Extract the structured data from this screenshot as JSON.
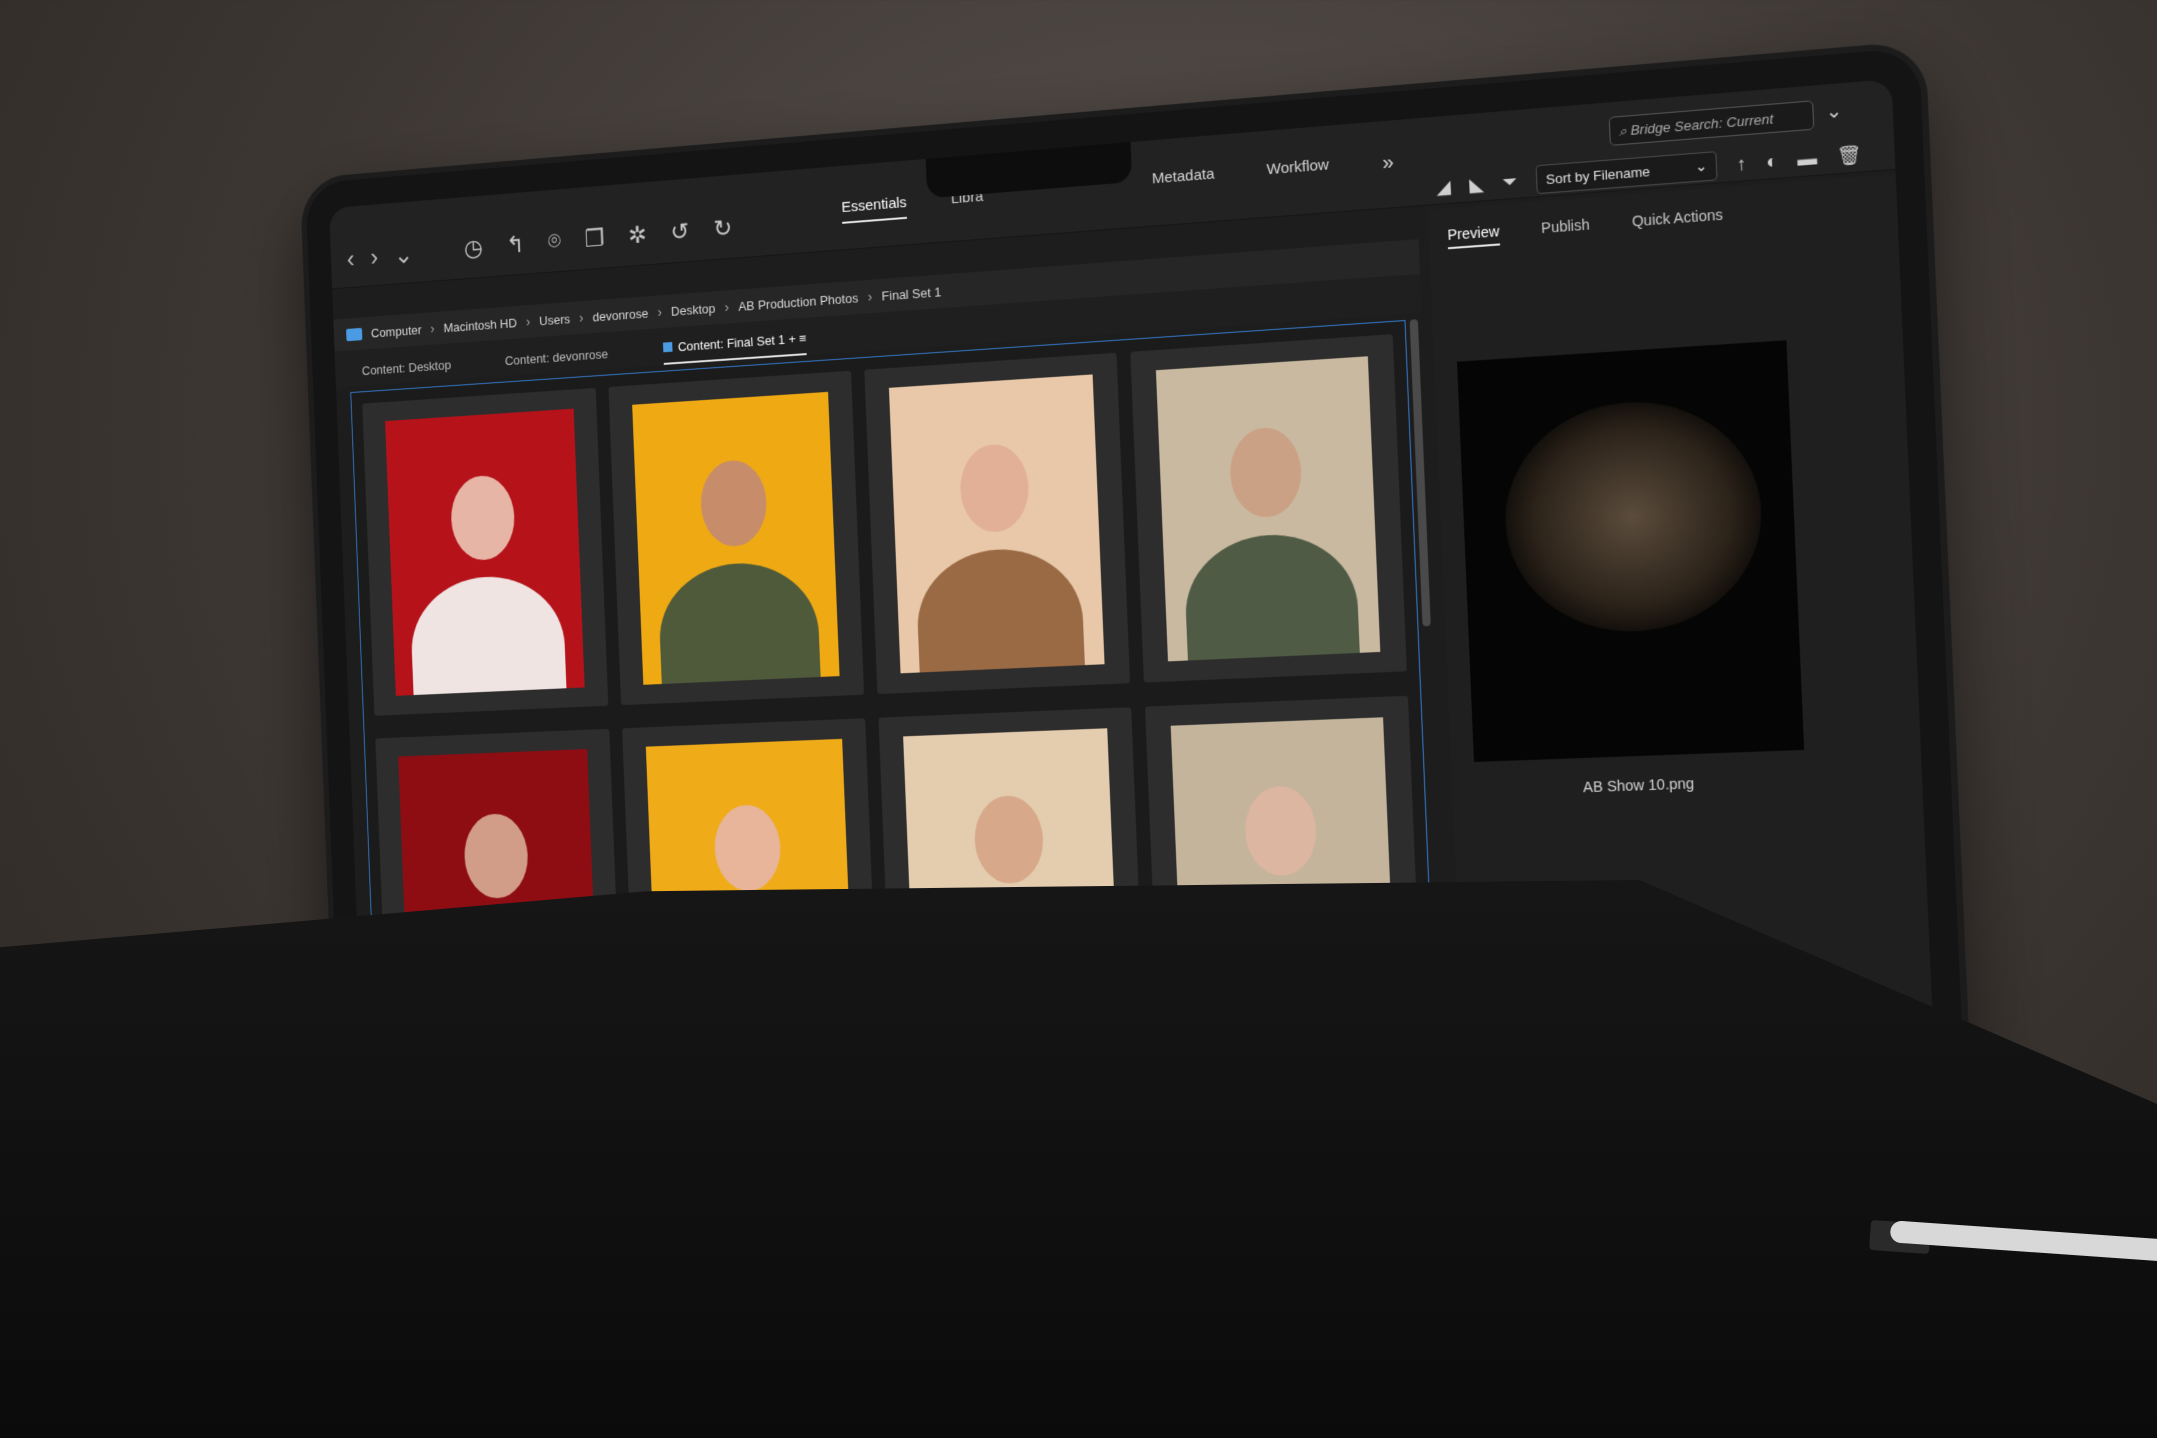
{
  "app": {
    "workspace_tabs": [
      "Essentials",
      "Libra"
    ],
    "right_tabs": [
      "Metadata",
      "Workflow"
    ],
    "more_label": "»",
    "search_placeholder": "Bridge Search: Current",
    "sort_label": "Sort by Filename"
  },
  "path": [
    "Computer",
    "Macintosh HD",
    "Users",
    "devonrose",
    "Desktop",
    "AB Production Photos",
    "Final Set 1"
  ],
  "content_tabs": [
    "Content: Desktop",
    "Content: devonrose",
    "Content: Final Set 1"
  ],
  "panel_tabs": [
    "Preview",
    "Publish",
    "Quick Actions"
  ],
  "preview": {
    "caption": "AB Show 10.png"
  },
  "thumbnails": [
    {
      "bg": "#b5121a",
      "skin": "#e7b5a6",
      "cloth": "#efe4e2"
    },
    {
      "bg": "#efaa13",
      "skin": "#c78c6a",
      "cloth": "#4f5a3a"
    },
    {
      "bg": "#e8c8a8",
      "skin": "#e2b096",
      "cloth": "#9a6a45"
    },
    {
      "bg": "#c9b9a0",
      "skin": "#caa184",
      "cloth": "#4f5b44"
    },
    {
      "bg": "#8e0d13",
      "skin": "#d19c88",
      "cloth": "#1b1515"
    },
    {
      "bg": "#efac18",
      "skin": "#e8b49a",
      "cloth": "#6f8a36"
    },
    {
      "bg": "#e4ccae",
      "skin": "#d7a889",
      "cloth": "#efe4cf"
    },
    {
      "bg": "#c4b49c",
      "skin": "#dcb6a0",
      "cloth": "#e7dfd7"
    }
  ],
  "colors": {
    "accent": "#3478c8",
    "folder": "#4a9be3"
  }
}
